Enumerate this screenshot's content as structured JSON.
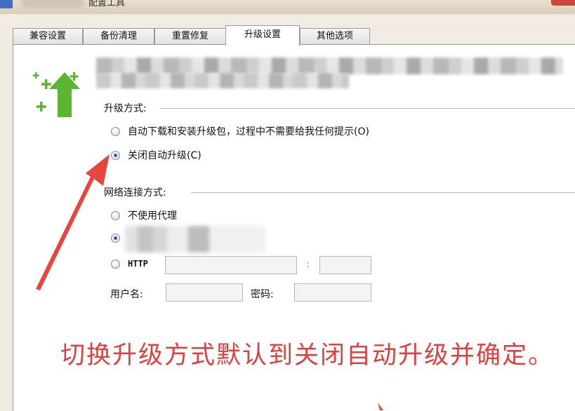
{
  "window": {
    "title": "配置工具"
  },
  "tabs": [
    {
      "label": "兼容设置",
      "active": false
    },
    {
      "label": "备份清理",
      "active": false
    },
    {
      "label": "重置修复",
      "active": false
    },
    {
      "label": "升级设置",
      "active": true
    },
    {
      "label": "其他选项",
      "active": false
    }
  ],
  "upgrade": {
    "group_label": "升级方式:",
    "options": [
      {
        "label": "自动下载和安装升级包，过程中不需要给我任何提示(O)",
        "checked": false
      },
      {
        "label": "关闭自动升级(C)",
        "checked": true
      }
    ]
  },
  "network": {
    "group_label": "网络连接方式:",
    "options": [
      {
        "label": "不使用代理",
        "checked": false
      },
      {
        "label": "",
        "checked": true
      },
      {
        "label": "HTTP",
        "checked": false
      }
    ],
    "host_value": "",
    "colon": ":",
    "port_value": "",
    "username_label": "用户名:",
    "username_value": "",
    "password_label": "密码:",
    "password_value": ""
  },
  "annotation": {
    "text": "切换升级方式默认到关闭自动升级并确定。",
    "color": "#e0403d"
  },
  "colors": {
    "accent_green": "#5cb531",
    "annotation_red": "#e0403d",
    "radio_dot": "#2a5db0"
  },
  "icons": {
    "upgrade": "upgrade-arrow-icon"
  }
}
